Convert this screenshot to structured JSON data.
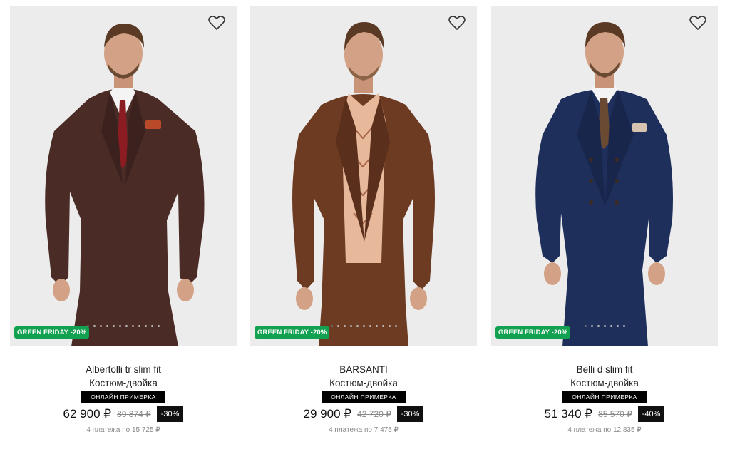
{
  "products": [
    {
      "name": "Albertolli tr slim fit",
      "type": "Костюм-двойка",
      "try_on": "ОНЛАЙН ПРИМЕРКА",
      "price": "62 900 ₽",
      "old_price": "89 874 ₽",
      "discount": "-30%",
      "installments": "4 платежа по 15 725 ₽",
      "promo": "GREEN FRIDAY -20%",
      "suit_color": "#4a2b26",
      "tie_color": "#8b1c22"
    },
    {
      "name": "BARSANTI",
      "type": "Костюм-двойка",
      "try_on": "ОНЛАЙН ПРИМЕРКА",
      "price": "29 900 ₽",
      "old_price": "42 720 ₽",
      "discount": "-30%",
      "installments": "4 платежа по 7 475 ₽",
      "promo": "GREEN FRIDAY -20%",
      "suit_color": "#6d3a22",
      "tie_color": "#e8b89a"
    },
    {
      "name": "Belli d slim fit",
      "type": "Костюм-двойка",
      "try_on": "ОНЛАЙН ПРИМЕРКА",
      "price": "51 340 ₽",
      "old_price": "85 570 ₽",
      "discount": "-40%",
      "installments": "4 платежа по 12 835 ₽",
      "promo": "GREEN FRIDAY -20%",
      "suit_color": "#1e2f5c",
      "tie_color": "#6b4a33"
    }
  ],
  "icons": {
    "favorite": "heart-outline-icon"
  },
  "colors": {
    "promo_badge": "#12a150",
    "discount_badge": "#111111",
    "card_bg": "#ececec"
  }
}
